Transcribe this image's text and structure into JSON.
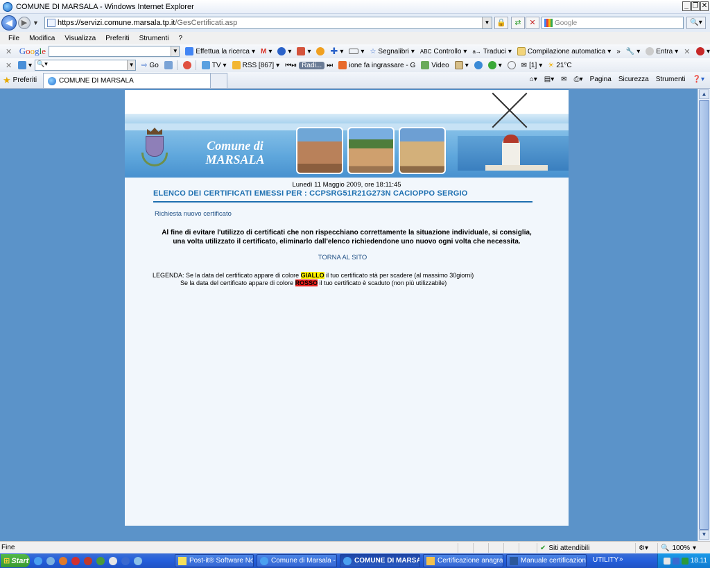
{
  "window": {
    "title": "COMUNE DI MARSALA - Windows Internet Explorer",
    "controls": {
      "minimize": "_",
      "restore": "❐",
      "close": "✕"
    }
  },
  "address": {
    "scheme": "https://servizi.comune.",
    "host": "marsala.tp.it",
    "path": "/GesCertificati.asp",
    "search_placeholder": "Google"
  },
  "menu": [
    "File",
    "Modifica",
    "Visualizza",
    "Preferiti",
    "Strumenti",
    "?"
  ],
  "toolbar1": {
    "google_logo": [
      "G",
      "o",
      "o",
      "g",
      "l",
      "e"
    ],
    "search_web": "Effettua la ricerca",
    "bookmarks": "Segnalibri",
    "spellcheck": "Controllo",
    "translate": "Traduci",
    "autofill": "Compilazione automatica",
    "signin": "Entra"
  },
  "toolbar2": {
    "go": "Go",
    "tv": "TV",
    "rss": "RSS [867]",
    "radio": "Radi...",
    "ticker": "ione fa ingrassare - G",
    "video": "Video",
    "mail_count": "[1]",
    "weather": "21°C"
  },
  "favbar": {
    "favorites": "Preferiti",
    "tab_title": "COMUNE DI MARSALA",
    "page": "Pagina",
    "safety": "Sicurezza",
    "tools": "Strumenti"
  },
  "page": {
    "banner_title_line1": "Comune di",
    "banner_title_line2": "MARSALA",
    "datetime": "Lunedì 11 Maggio 2009, ore 18:11:45",
    "heading": "ELENCO DEI CERTIFICATI EMESSI PER : CCPSRG51R21G273N CACIOPPO SERGIO",
    "new_request": "Richiesta nuovo certificato",
    "notice_line1": "Al fine di evitare l'utilizzo di certificati che non rispecchiano correttamente la situazione individuale, si consiglia,",
    "notice_line2": "una volta utilizzato il certificato, eliminarlo dall'elenco richiedendone uno nuovo ogni volta che necessita.",
    "back_link": "TORNA AL SITO",
    "legend": {
      "label": "LEGENDA:",
      "l1_pre": "Se la data del certificato appare di colore",
      "l1_color": "GIALLO",
      "l1_post": "il tuo certificato stà per scadere (al massimo 30giorni)",
      "l2_pre": "Se la data del certificato appare di colore",
      "l2_color": "ROSSO",
      "l2_post": "il tuo certificato è scaduto (non più utilizzabile)"
    }
  },
  "status": {
    "text": "Fine",
    "zone": "Siti attendibili",
    "zoom": "100%"
  },
  "taskbar": {
    "start": "Start",
    "tasks": [
      "Post-it® Software No...",
      "Comune di Marsala - S...",
      "COMUNE DI MARSA...",
      "Certificazione anagraf...",
      "Manuale certificazione..."
    ],
    "utility": "UTILITY",
    "clock": "18.11"
  },
  "colors": {
    "page_bg": "#5b93c9",
    "heading": "#1d6fb0",
    "yellow": "#fff200",
    "red": "#e8201c"
  }
}
